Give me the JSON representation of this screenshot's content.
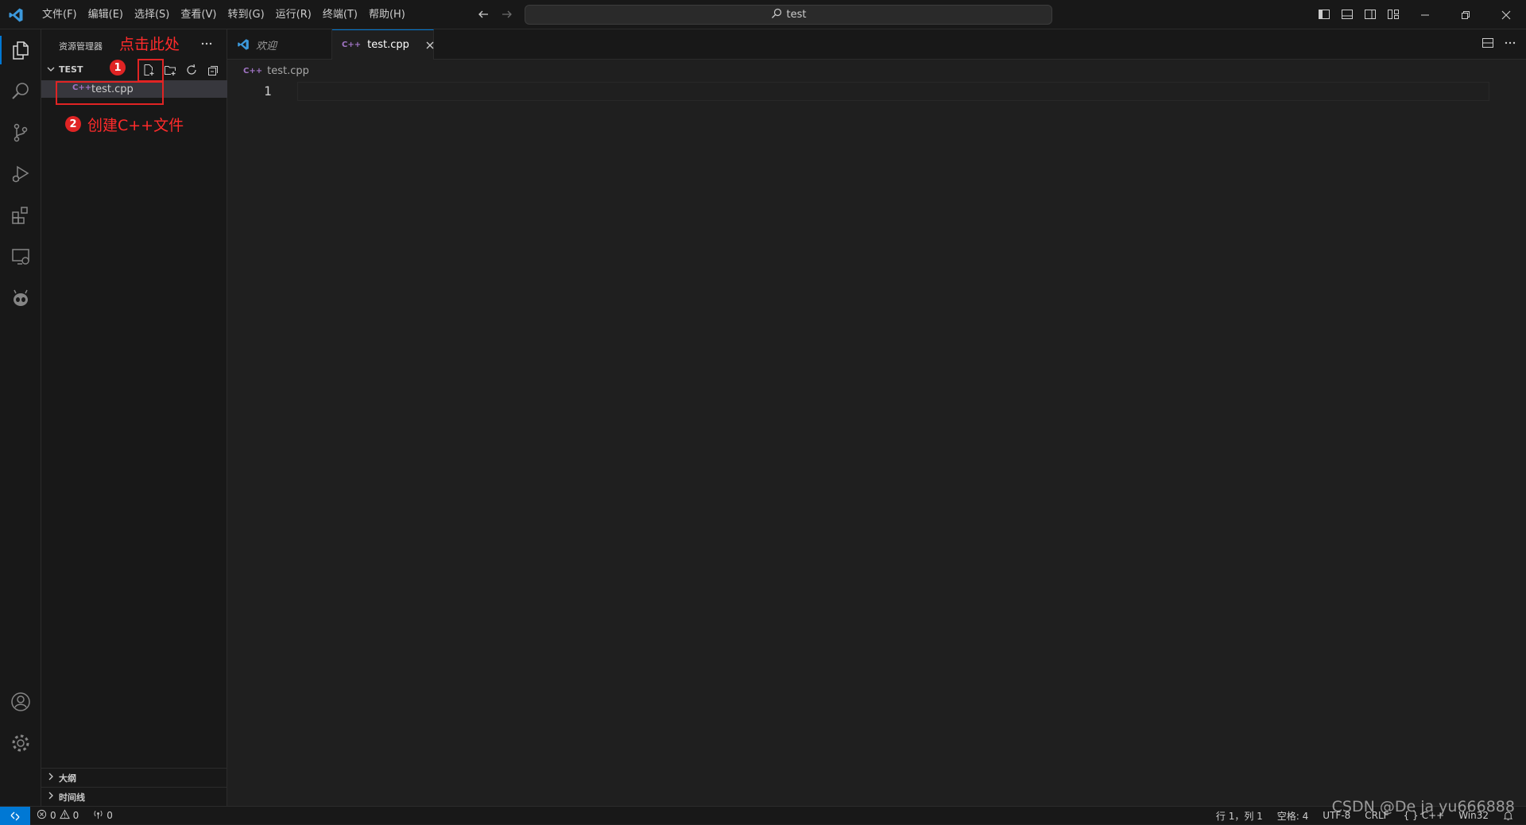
{
  "titlebar": {
    "menu": [
      "文件(F)",
      "编辑(E)",
      "选择(S)",
      "查看(V)",
      "转到(G)",
      "运行(R)",
      "终端(T)",
      "帮助(H)"
    ],
    "search_text": "test"
  },
  "sidebar": {
    "title": "资源管理器",
    "folder_name": "TEST",
    "file_icon_text": "C++",
    "file_name": "test.cpp",
    "sections": [
      "大纲",
      "时间线"
    ]
  },
  "annotations": {
    "step1_num": "1",
    "step1_text": "点击此处",
    "step2_num": "2",
    "step2_text": "创建C++文件",
    "color": "#e02424"
  },
  "editor": {
    "tabs": [
      {
        "label": "欢迎",
        "italic": true
      },
      {
        "label": "test.cpp",
        "active": true
      }
    ],
    "breadcrumb": "test.cpp",
    "line_numbers": [
      "1"
    ]
  },
  "statusbar": {
    "errors": "0",
    "warnings": "0",
    "ports": "0",
    "position": "行 1，列 1",
    "spaces": "空格: 4",
    "encoding": "UTF-8",
    "eol": "CRLF",
    "language": "C++",
    "platform": "Win32"
  },
  "watermark": "CSDN @De ja yu666888",
  "colors": {
    "accent": "#0078d4",
    "background": "#1f1f1f",
    "sidebar": "#181818",
    "cpp_icon": "#a074c4"
  }
}
